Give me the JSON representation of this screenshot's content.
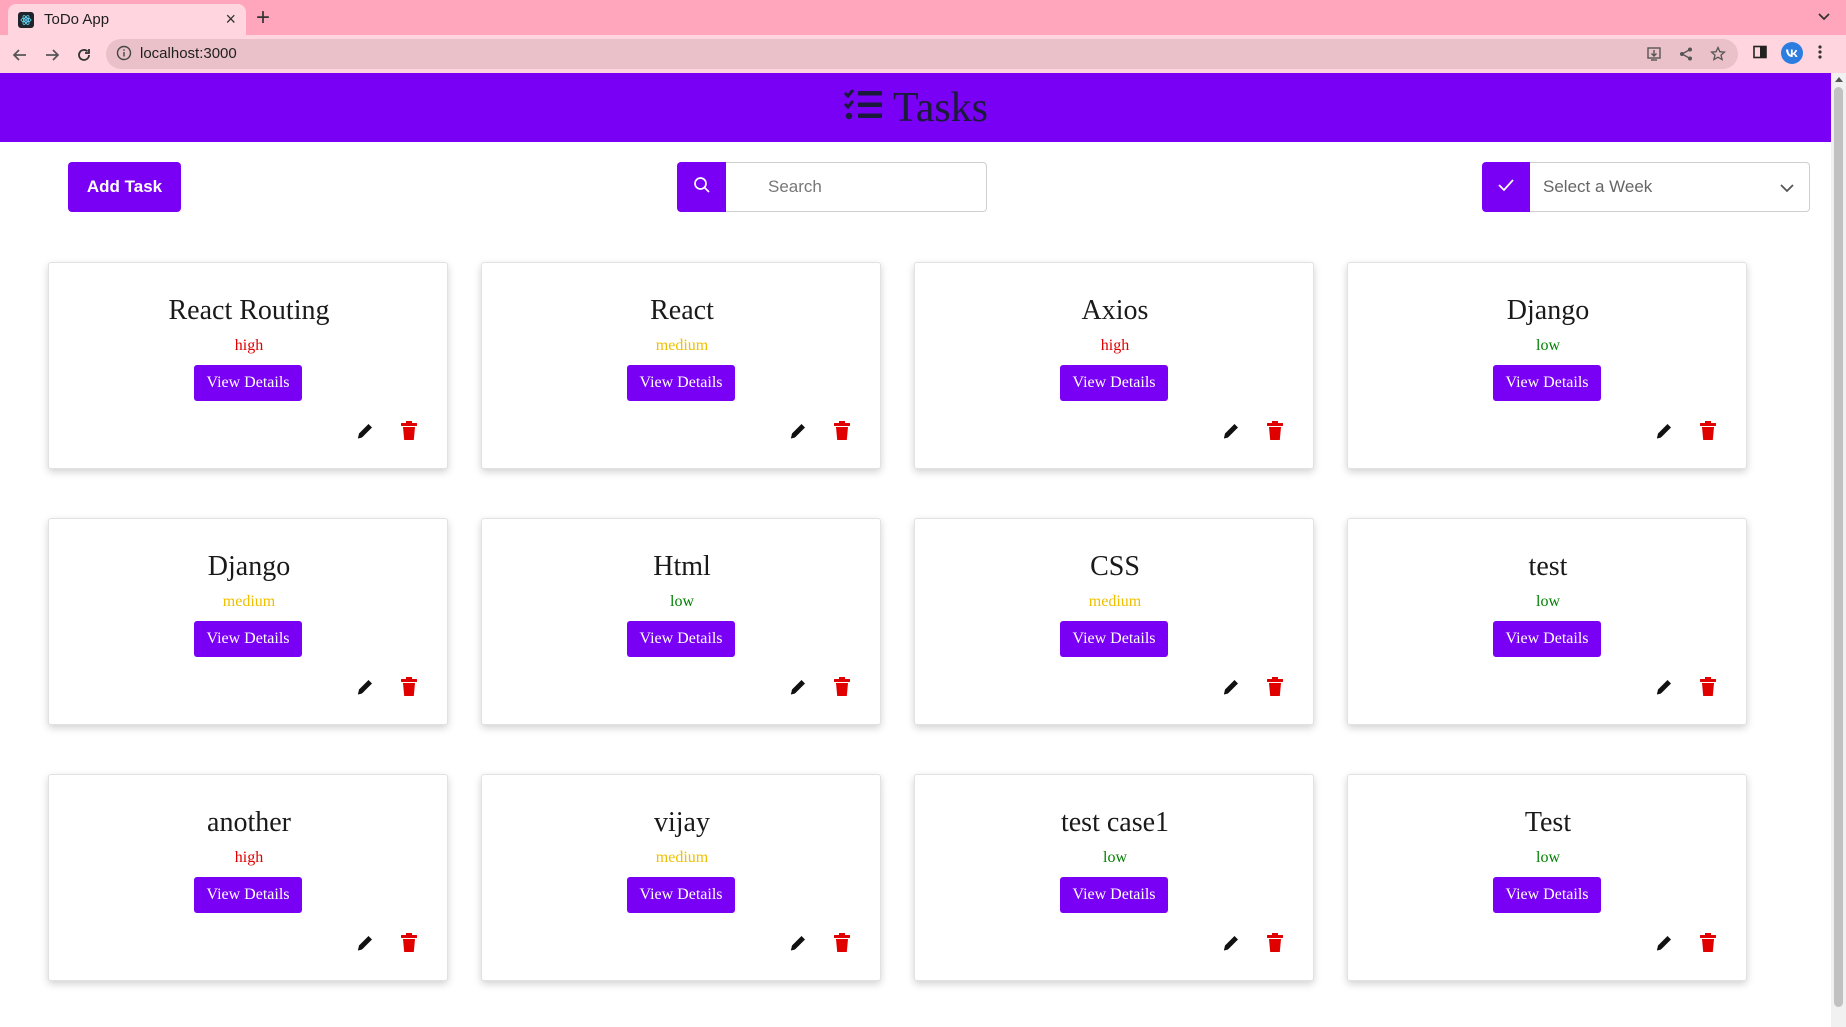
{
  "browser": {
    "tab_title": "ToDo App",
    "tab_close": "×",
    "new_tab": "+",
    "url": "localhost:3000"
  },
  "header": {
    "title": "Tasks",
    "icon": "tasks-list-icon"
  },
  "toolbar": {
    "add_task_label": "Add Task",
    "search_placeholder": "Search",
    "week_select_value": "Select a Week"
  },
  "colors": {
    "accent": "#7a00f5",
    "priority_high": "#e00000",
    "priority_medium": "#f0c000",
    "priority_low": "#008000"
  },
  "tasks": [
    {
      "title": "React Routing",
      "priority": "high",
      "button": "View Details"
    },
    {
      "title": "React",
      "priority": "medium",
      "button": "View Details"
    },
    {
      "title": "Axios",
      "priority": "high",
      "button": "View Details"
    },
    {
      "title": "Django",
      "priority": "low",
      "button": "View Details"
    },
    {
      "title": "Django",
      "priority": "medium",
      "button": "View Details"
    },
    {
      "title": "Html",
      "priority": "low",
      "button": "View Details"
    },
    {
      "title": "CSS",
      "priority": "medium",
      "button": "View Details"
    },
    {
      "title": "test",
      "priority": "low",
      "button": "View Details"
    },
    {
      "title": "another",
      "priority": "high",
      "button": "View Details"
    },
    {
      "title": "vijay",
      "priority": "medium",
      "button": "View Details"
    },
    {
      "title": "test case1",
      "priority": "low",
      "button": "View Details"
    },
    {
      "title": "Test",
      "priority": "low",
      "button": "View Details"
    }
  ]
}
